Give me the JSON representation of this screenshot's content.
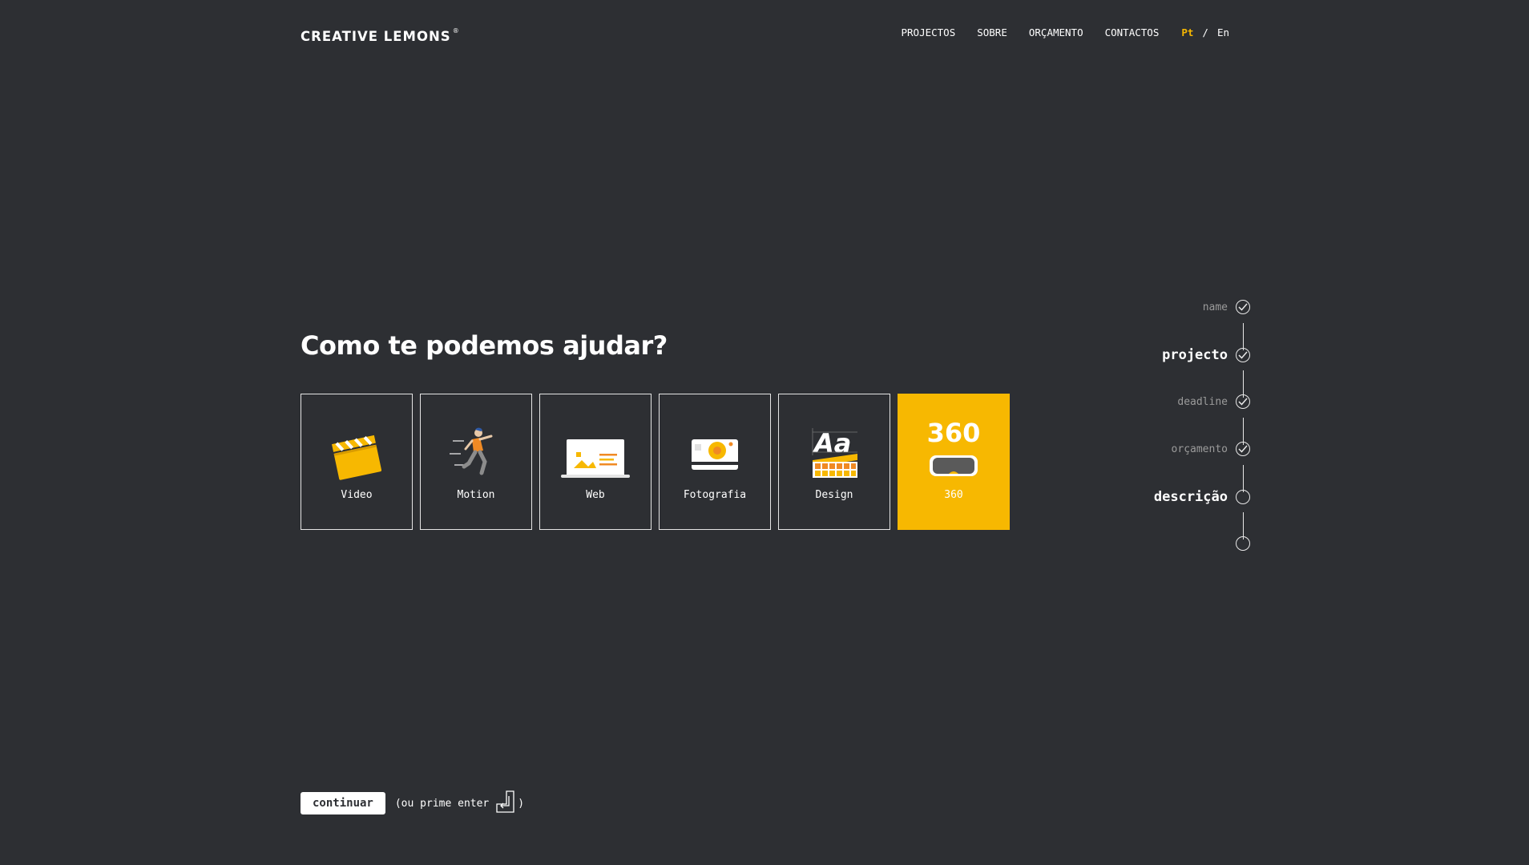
{
  "header": {
    "logo": "CREATIVE LEMONS",
    "logo_mark": "®",
    "nav": [
      "PROJECTOS",
      "SOBRE",
      "ORÇAMENTO",
      "CONTACTOS"
    ],
    "lang_active": "Pt",
    "lang_separator": "/",
    "lang_other": "En"
  },
  "main": {
    "heading": "Como te podemos ajudar?",
    "cards": [
      {
        "label": "Video",
        "icon": "clapperboard-icon"
      },
      {
        "label": "Motion",
        "icon": "running-person-icon"
      },
      {
        "label": "Web",
        "icon": "laptop-icon"
      },
      {
        "label": "Fotografia",
        "icon": "camera-icon"
      },
      {
        "label": "Design",
        "icon": "typography-palette-icon"
      },
      {
        "label": "360",
        "big_text": "360",
        "icon": "vr-headset-icon",
        "selected": true
      }
    ]
  },
  "steps": [
    {
      "label": "name",
      "done": true
    },
    {
      "label": "projecto",
      "done": true,
      "current": true
    },
    {
      "label": "deadline",
      "done": true
    },
    {
      "label": "orçamento",
      "done": true
    },
    {
      "label": "descrição",
      "done": false,
      "current": true
    },
    {
      "label": "",
      "done": false
    }
  ],
  "footer": {
    "continue_label": "continuar",
    "hint_prefix": "(ou prime enter",
    "hint_suffix": ")"
  },
  "colors": {
    "background": "#2d2f33",
    "accent": "#f7b801",
    "text": "#ffffff"
  }
}
